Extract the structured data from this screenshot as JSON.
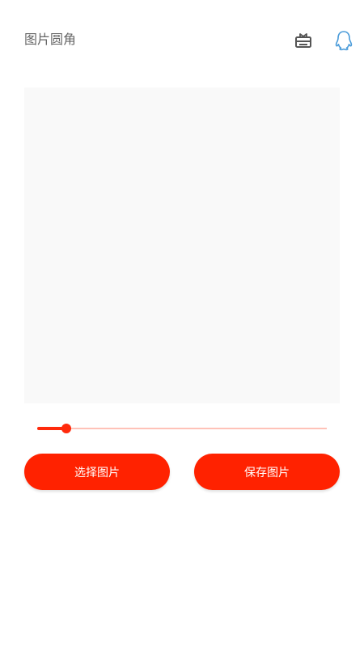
{
  "header": {
    "title": "图片圆角",
    "icons": [
      "gift-card-icon",
      "qq-icon"
    ]
  },
  "slider": {
    "value": 0.1
  },
  "buttons": {
    "select_label": "选择图片",
    "save_label": "保存图片"
  },
  "colors": {
    "accent": "#ff2200",
    "slider_track": "#ffc2b8",
    "title": "#666666",
    "gift_icon": "#555555",
    "qq_icon": "#4a9bd9",
    "preview_bg": "#f9f9f9"
  }
}
